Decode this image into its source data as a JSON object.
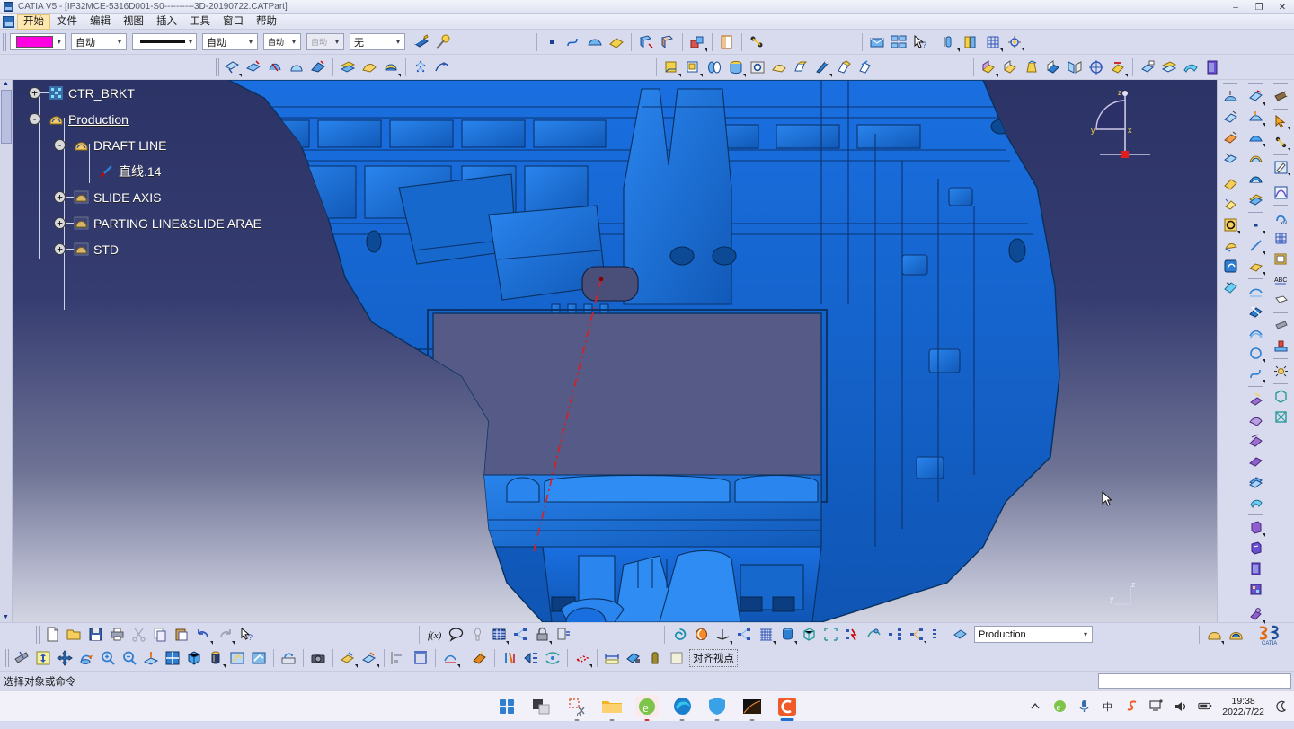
{
  "window": {
    "title": "CATIA V5 - [IP32MCE-5316D001-S0----------3D-20190722.CATPart]",
    "minimize": "–",
    "maximize": "❐",
    "close": "✕"
  },
  "menu": {
    "items": [
      {
        "label": "开始",
        "name": "menu-start",
        "active": true
      },
      {
        "label": "文件",
        "name": "menu-file",
        "active": false
      },
      {
        "label": "编辑",
        "name": "menu-edit",
        "active": false
      },
      {
        "label": "视图",
        "name": "menu-view",
        "active": false
      },
      {
        "label": "插入",
        "name": "menu-insert",
        "active": false
      },
      {
        "label": "工具",
        "name": "menu-tools",
        "active": false
      },
      {
        "label": "窗口",
        "name": "menu-window",
        "active": false
      },
      {
        "label": "帮助",
        "name": "menu-help",
        "active": false
      }
    ]
  },
  "graphic_properties": {
    "fill_color": "#ff00e0",
    "transparency": "自动",
    "line_weight": "自动",
    "line_type_label": "自动",
    "point_symbol": "自动",
    "layer": "无",
    "linetype_preview": "solid"
  },
  "tree": {
    "items": [
      {
        "label": "CTR_BRKT",
        "icon": "part-icon",
        "expander": "+",
        "depth": 0,
        "underline": false
      },
      {
        "label": "Production",
        "icon": "body-icon",
        "expander": "-",
        "depth": 0,
        "underline": true
      },
      {
        "label": "DRAFT LINE",
        "icon": "geoset-icon",
        "expander": "-",
        "depth": 1,
        "underline": false
      },
      {
        "label": "直线.14",
        "icon": "line-icon",
        "expander": "",
        "depth": 2,
        "underline": false
      },
      {
        "label": "SLIDE AXIS",
        "icon": "geoset-hidden-icon",
        "expander": "+",
        "depth": 1,
        "underline": false
      },
      {
        "label": "PARTING LINE&SLIDE ARAE",
        "icon": "geoset-hidden-icon",
        "expander": "+",
        "depth": 1,
        "underline": false
      },
      {
        "label": "STD",
        "icon": "geoset-hidden-icon",
        "expander": "+",
        "depth": 1,
        "underline": false
      }
    ]
  },
  "viewport": {
    "compass": {
      "z_label": "z",
      "y_label": "y",
      "x_label": "x"
    },
    "axis_indicator": {
      "z_label": "z",
      "y_label": "y"
    },
    "model_color": "#1268d8",
    "background_top": "#2c3366",
    "background_bottom": "#d3d5e2",
    "highlight_line_color": "#e01c1c"
  },
  "bottom": {
    "workbench_combo_value": "Production"
  },
  "status": {
    "message": "选择对象或命令",
    "input_value": ""
  },
  "taskbar": {
    "apps": [
      {
        "name": "start-button",
        "label": "Start"
      },
      {
        "name": "task-view-button",
        "label": "Task View"
      },
      {
        "name": "snip-tool-button",
        "label": "Snipping Tool"
      },
      {
        "name": "file-explorer-button",
        "label": "File Explorer"
      },
      {
        "name": "ie-browser-button",
        "label": "Internet Explorer"
      },
      {
        "name": "edge-browser-button",
        "label": "Microsoft Edge"
      },
      {
        "name": "security-button",
        "label": "Windows Security"
      },
      {
        "name": "terminal-button",
        "label": "Terminal"
      },
      {
        "name": "camtasia-button",
        "label": "Camtasia"
      }
    ],
    "tray": {
      "time": "19:38",
      "date": "2022/7/22"
    }
  }
}
